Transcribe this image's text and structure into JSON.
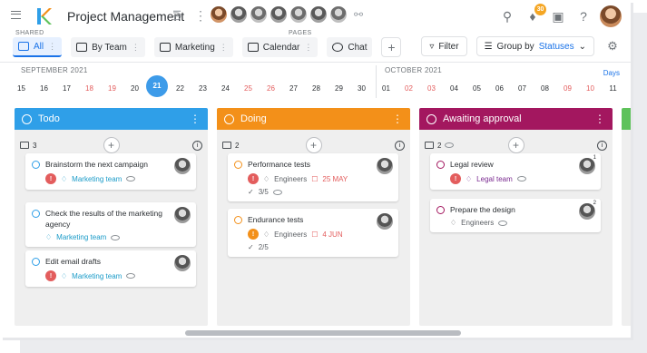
{
  "app": {
    "title": "Project Management",
    "notifications_count": "30"
  },
  "labels": {
    "shared": "SHARED",
    "pages": "PAGES"
  },
  "views": [
    {
      "label": "All",
      "active": true
    },
    {
      "label": "By Team",
      "active": false
    },
    {
      "label": "Marketing",
      "active": false
    },
    {
      "label": "Calendar",
      "active": false
    },
    {
      "label": "Chat",
      "active": false
    }
  ],
  "toolbar": {
    "filter": "Filter",
    "group_by": "Group by",
    "group_value": "Statuses"
  },
  "calendar": {
    "month1": "SEPTEMBER 2021",
    "month2": "OCTOBER 2021",
    "days_link": "Days",
    "days": [
      {
        "n": "15",
        "we": false
      },
      {
        "n": "16",
        "we": false
      },
      {
        "n": "17",
        "we": false
      },
      {
        "n": "18",
        "we": true
      },
      {
        "n": "19",
        "we": true
      },
      {
        "n": "20",
        "we": false
      },
      {
        "n": "21",
        "we": false,
        "today": true
      },
      {
        "n": "22",
        "we": false
      },
      {
        "n": "23",
        "we": false
      },
      {
        "n": "24",
        "we": false
      },
      {
        "n": "25",
        "we": true
      },
      {
        "n": "26",
        "we": true
      },
      {
        "n": "27",
        "we": false
      },
      {
        "n": "28",
        "we": false
      },
      {
        "n": "29",
        "we": false
      },
      {
        "n": "30",
        "we": false
      },
      {
        "n": "01",
        "we": false
      },
      {
        "n": "02",
        "we": true
      },
      {
        "n": "03",
        "we": true
      },
      {
        "n": "04",
        "we": false
      },
      {
        "n": "05",
        "we": false
      },
      {
        "n": "06",
        "we": false
      },
      {
        "n": "07",
        "we": false
      },
      {
        "n": "08",
        "we": false
      },
      {
        "n": "09",
        "we": true
      },
      {
        "n": "10",
        "we": true
      },
      {
        "n": "11",
        "we": false
      }
    ]
  },
  "columns": [
    {
      "title": "Todo",
      "color": "#2f9fe8",
      "count": "3",
      "cards": [
        {
          "title": "Brainstorm the next campaign",
          "tag": "Marketing team",
          "prio": "red",
          "status": "#2f9fe8"
        },
        {
          "title": "Check the results of the marketing agency",
          "tag": "Marketing team",
          "prio": "none",
          "status": "#2f9fe8"
        },
        {
          "title": "Edit email drafts",
          "tag": "Marketing team",
          "prio": "red",
          "status": "#2f9fe8"
        }
      ]
    },
    {
      "title": "Doing",
      "color": "#f39019",
      "count": "2",
      "cards": [
        {
          "title": "Performance tests",
          "tag": "Engineers",
          "prio": "red",
          "due": "25 MAY",
          "checks": "3/5",
          "status": "#f39019"
        },
        {
          "title": "Endurance tests",
          "tag": "Engineers",
          "prio": "orange",
          "due": "4 JUN",
          "checks": "2/5",
          "status": "#f39019"
        }
      ]
    },
    {
      "title": "Awaiting approval",
      "color": "#a3175f",
      "count": "2",
      "cards": [
        {
          "title": "Legal review",
          "tag": "Legal team",
          "prio": "red",
          "status": "#a3175f",
          "cnt": "1"
        },
        {
          "title": "Prepare the design",
          "tag": "Engineers",
          "prio": "none",
          "status": "#a3175f",
          "cnt": "2"
        }
      ]
    }
  ]
}
